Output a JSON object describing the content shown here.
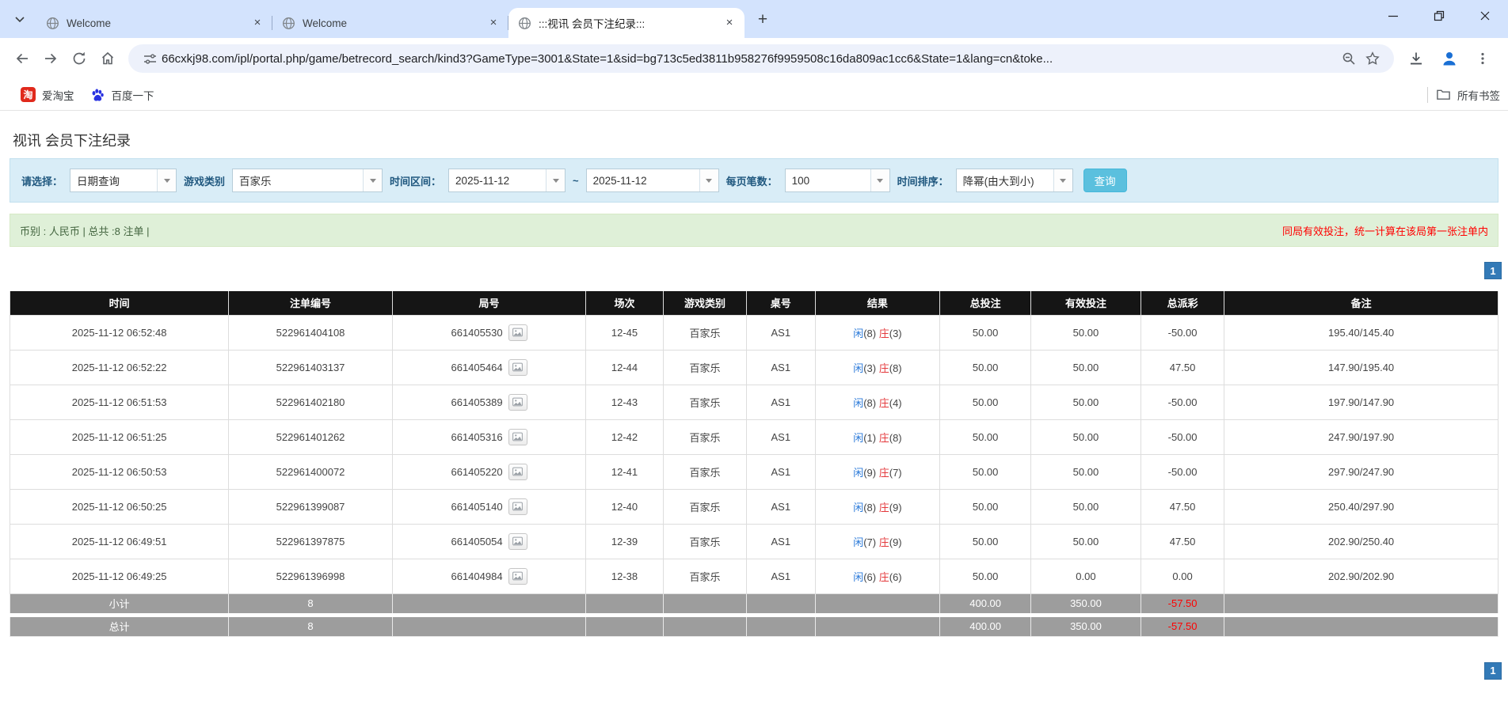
{
  "colors": {
    "chrome_bg": "#d3e3fd",
    "filter_bg": "#d9edf7",
    "accent_button": "#5bc0de",
    "summary_green": "#dff0d8",
    "alert_red": "#ff0000",
    "link_blue": "#2b7ad9",
    "banker_red": "#e4393c",
    "table_header_bg": "#151515",
    "table_footer_gray": "#9d9d9d",
    "pager_blue": "#337ab7"
  },
  "browser": {
    "tabs": [
      {
        "title": "Welcome",
        "active": false
      },
      {
        "title": "Welcome",
        "active": false
      },
      {
        "title": ":::视讯 会员下注纪录:::",
        "active": true
      }
    ],
    "url": "66cxkj98.com/ipl/portal.php/game/betrecord_search/kind3?GameType=3001&State=1&sid=bg713c5ed3811b958276f9959508c16da809ac1cc6&State=1&lang=cn&toke...",
    "bookmarks": [
      {
        "label": "爱淘宝"
      },
      {
        "label": "百度一下"
      }
    ],
    "all_bookmarks_label": "所有书签"
  },
  "page": {
    "title": "视讯 会员下注纪录",
    "filters": {
      "controls": [
        {
          "name": "query-type",
          "label": "请选择：",
          "value": "日期查询"
        },
        {
          "name": "game-type",
          "label": "游戏类别",
          "value": "百家乐"
        },
        {
          "name": "date-from",
          "label": "时间区间：",
          "value": "2025-11-12"
        },
        {
          "name": "date-to",
          "label": "~",
          "value": "2025-11-12"
        },
        {
          "name": "per-page",
          "label": "每页笔数：",
          "value": "100"
        },
        {
          "name": "sort-order",
          "label": "时间排序：",
          "value": "降幂(由大到小)"
        }
      ],
      "search_button": "查询"
    },
    "summary": {
      "left": "币别 : 人民币 | 总共 :8 注单 |",
      "right": "同局有效投注，统一计算在该局第一张注单内"
    },
    "pagination": {
      "page": "1"
    },
    "table": {
      "headers": [
        "时间",
        "注单编号",
        "局号",
        "场次",
        "游戏类别",
        "桌号",
        "结果",
        "总投注",
        "有效投注",
        "总派彩",
        "备注"
      ],
      "rows": [
        {
          "time": "2025-11-12 06:52:48",
          "bet_no": "522961404108",
          "round_no": "661405530",
          "session": "12-45",
          "game": "百家乐",
          "table_no": "AS1",
          "player": "闲",
          "player_score": "(8)",
          "banker": "庄",
          "banker_score": "(3)",
          "total_bet": "50.00",
          "valid_bet": "50.00",
          "payout": "-50.00",
          "remark": "195.40/145.40"
        },
        {
          "time": "2025-11-12 06:52:22",
          "bet_no": "522961403137",
          "round_no": "661405464",
          "session": "12-44",
          "game": "百家乐",
          "table_no": "AS1",
          "player": "闲",
          "player_score": "(3)",
          "banker": "庄",
          "banker_score": "(8)",
          "total_bet": "50.00",
          "valid_bet": "50.00",
          "payout": "47.50",
          "remark": "147.90/195.40"
        },
        {
          "time": "2025-11-12 06:51:53",
          "bet_no": "522961402180",
          "round_no": "661405389",
          "session": "12-43",
          "game": "百家乐",
          "table_no": "AS1",
          "player": "闲",
          "player_score": "(8)",
          "banker": "庄",
          "banker_score": "(4)",
          "total_bet": "50.00",
          "valid_bet": "50.00",
          "payout": "-50.00",
          "remark": "197.90/147.90"
        },
        {
          "time": "2025-11-12 06:51:25",
          "bet_no": "522961401262",
          "round_no": "661405316",
          "session": "12-42",
          "game": "百家乐",
          "table_no": "AS1",
          "player": "闲",
          "player_score": "(1)",
          "banker": "庄",
          "banker_score": "(8)",
          "total_bet": "50.00",
          "valid_bet": "50.00",
          "payout": "-50.00",
          "remark": "247.90/197.90"
        },
        {
          "time": "2025-11-12 06:50:53",
          "bet_no": "522961400072",
          "round_no": "661405220",
          "session": "12-41",
          "game": "百家乐",
          "table_no": "AS1",
          "player": "闲",
          "player_score": "(9)",
          "banker": "庄",
          "banker_score": "(7)",
          "total_bet": "50.00",
          "valid_bet": "50.00",
          "payout": "-50.00",
          "remark": "297.90/247.90"
        },
        {
          "time": "2025-11-12 06:50:25",
          "bet_no": "522961399087",
          "round_no": "661405140",
          "session": "12-40",
          "game": "百家乐",
          "table_no": "AS1",
          "player": "闲",
          "player_score": "(8)",
          "banker": "庄",
          "banker_score": "(9)",
          "total_bet": "50.00",
          "valid_bet": "50.00",
          "payout": "47.50",
          "remark": "250.40/297.90"
        },
        {
          "time": "2025-11-12 06:49:51",
          "bet_no": "522961397875",
          "round_no": "661405054",
          "session": "12-39",
          "game": "百家乐",
          "table_no": "AS1",
          "player": "闲",
          "player_score": "(7)",
          "banker": "庄",
          "banker_score": "(9)",
          "total_bet": "50.00",
          "valid_bet": "50.00",
          "payout": "47.50",
          "remark": "202.90/250.40"
        },
        {
          "time": "2025-11-12 06:49:25",
          "bet_no": "522961396998",
          "round_no": "661404984",
          "session": "12-38",
          "game": "百家乐",
          "table_no": "AS1",
          "player": "闲",
          "player_score": "(6)",
          "banker": "庄",
          "banker_score": "(6)",
          "total_bet": "50.00",
          "valid_bet": "0.00",
          "payout": "0.00",
          "remark": "202.90/202.90"
        }
      ],
      "footer": [
        {
          "label": "小计",
          "count": "8",
          "total_bet": "400.00",
          "valid_bet": "350.00",
          "payout": "-57.50"
        },
        {
          "label": "总计",
          "count": "8",
          "total_bet": "400.00",
          "valid_bet": "350.00",
          "payout": "-57.50"
        }
      ]
    }
  }
}
